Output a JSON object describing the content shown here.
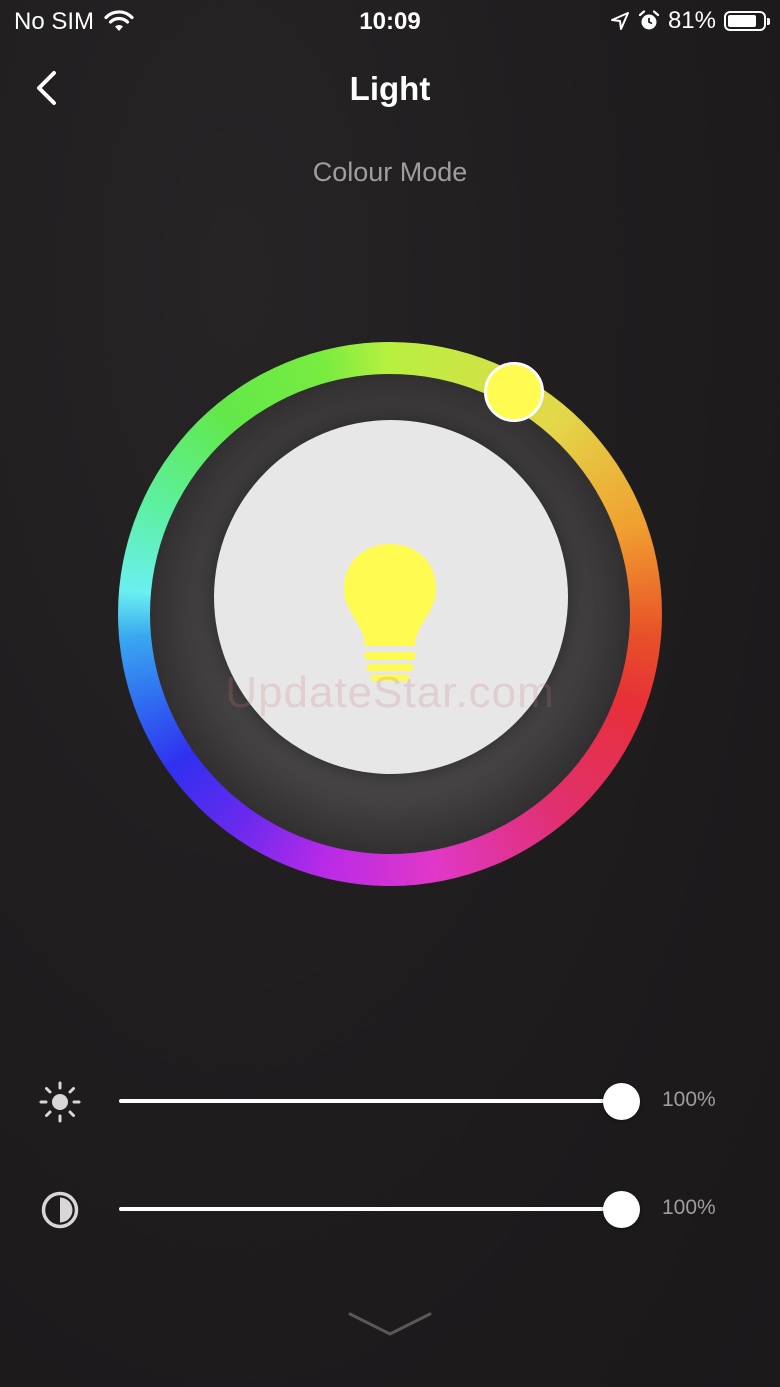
{
  "status_bar": {
    "carrier": "No SIM",
    "time": "10:09",
    "battery_percent": "81%",
    "battery_level": 0.81
  },
  "header": {
    "title": "Light",
    "back_icon": "chevron-left-icon"
  },
  "mode": {
    "label": "Colour Mode"
  },
  "color_wheel": {
    "selected_color": "#fffb50",
    "bulb_color": "#fffb50",
    "watermark": "UpdateStar.com"
  },
  "sliders": [
    {
      "icon": "brightness-icon",
      "value": 100,
      "value_label": "100%"
    },
    {
      "icon": "contrast-icon",
      "value": 100,
      "value_label": "100%"
    }
  ],
  "footer": {
    "collapse_icon": "chevron-down-icon"
  }
}
